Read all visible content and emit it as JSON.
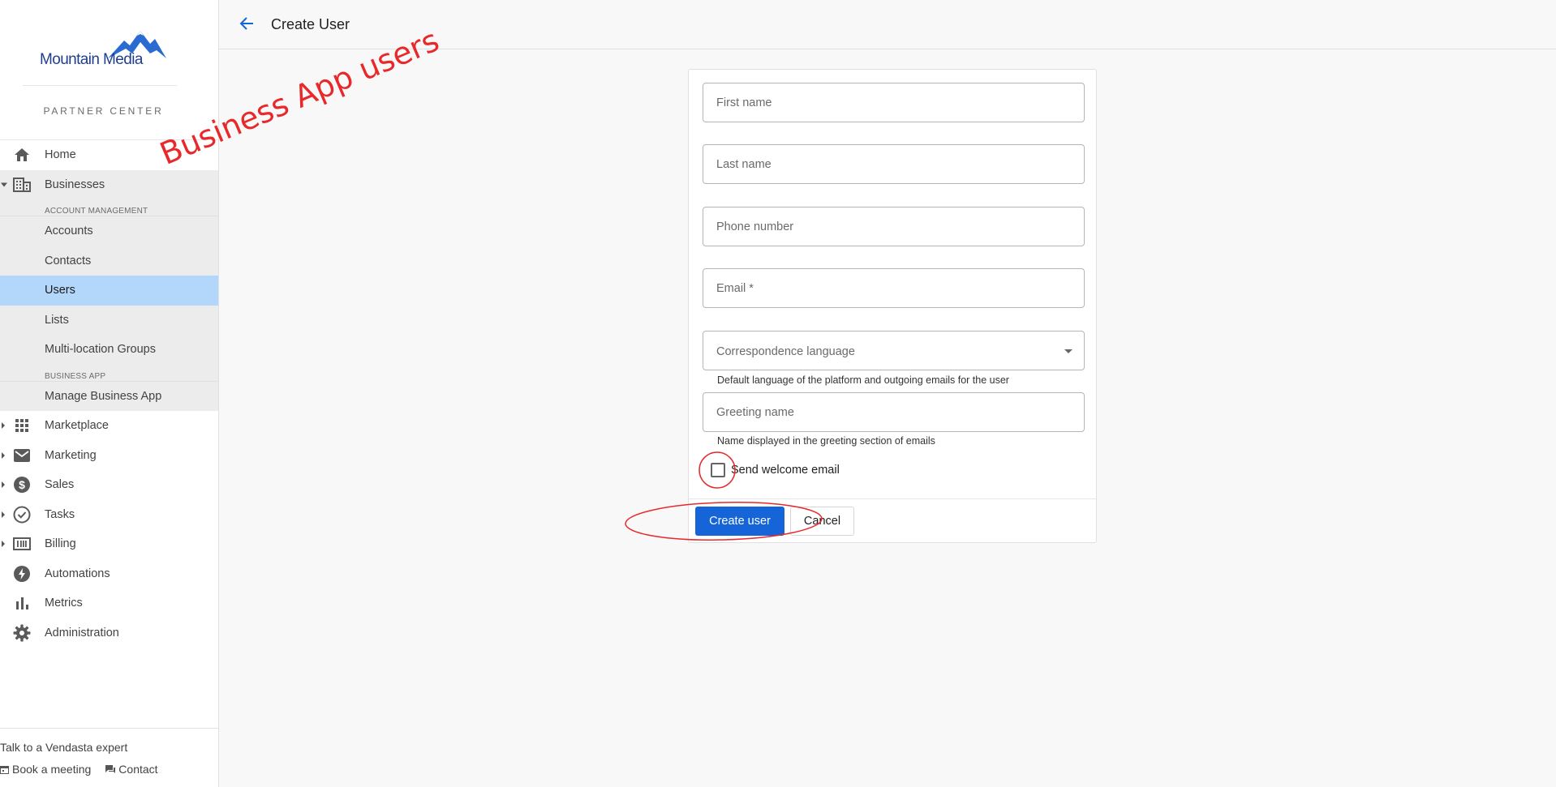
{
  "brand": {
    "name": "Mountain Media",
    "subtitle": "PARTNER CENTER",
    "color": "#1f3f8e",
    "mountain_color": "#2a6bd1"
  },
  "sidebar": {
    "items": [
      {
        "label": "Home",
        "icon": "home-icon"
      },
      {
        "label": "Businesses",
        "icon": "building-icon",
        "expanded": true
      },
      {
        "label": "Marketplace",
        "icon": "grid-icon"
      },
      {
        "label": "Marketing",
        "icon": "mail-icon"
      },
      {
        "label": "Sales",
        "icon": "dollar-icon"
      },
      {
        "label": "Tasks",
        "icon": "check-circle-icon"
      },
      {
        "label": "Billing",
        "icon": "billing-icon"
      },
      {
        "label": "Automations",
        "icon": "bolt-icon"
      },
      {
        "label": "Metrics",
        "icon": "bar-chart-icon"
      },
      {
        "label": "Administration",
        "icon": "gear-icon"
      }
    ],
    "businesses_sub": {
      "section1_header": "ACCOUNT MANAGEMENT",
      "section1_items": [
        "Accounts",
        "Contacts",
        "Users",
        "Lists",
        "Multi-location Groups"
      ],
      "active": "Users",
      "section2_header": "BUSINESS APP",
      "section2_items": [
        "Manage Business App"
      ]
    },
    "footer": {
      "title": "Talk to a Vendasta expert",
      "book_meeting": "Book a meeting",
      "contact": "Contact"
    }
  },
  "header": {
    "title": "Create User"
  },
  "form": {
    "first_name_placeholder": "First name",
    "last_name_placeholder": "Last name",
    "phone_placeholder": "Phone number",
    "email_placeholder": "Email *",
    "language_label": "Correspondence language",
    "language_hint": "Default language of the platform and outgoing emails for the user",
    "greeting_placeholder": "Greeting name",
    "greeting_hint": "Name displayed in the greeting section of emails",
    "welcome_email_label": "Send welcome email",
    "welcome_email_checked": false,
    "create_button": "Create user",
    "cancel_button": "Cancel"
  },
  "annotation": {
    "text": "Business App users",
    "color": "#e8282a"
  },
  "colors": {
    "primary": "#1565d8",
    "active_nav": "#b3d6fb"
  }
}
